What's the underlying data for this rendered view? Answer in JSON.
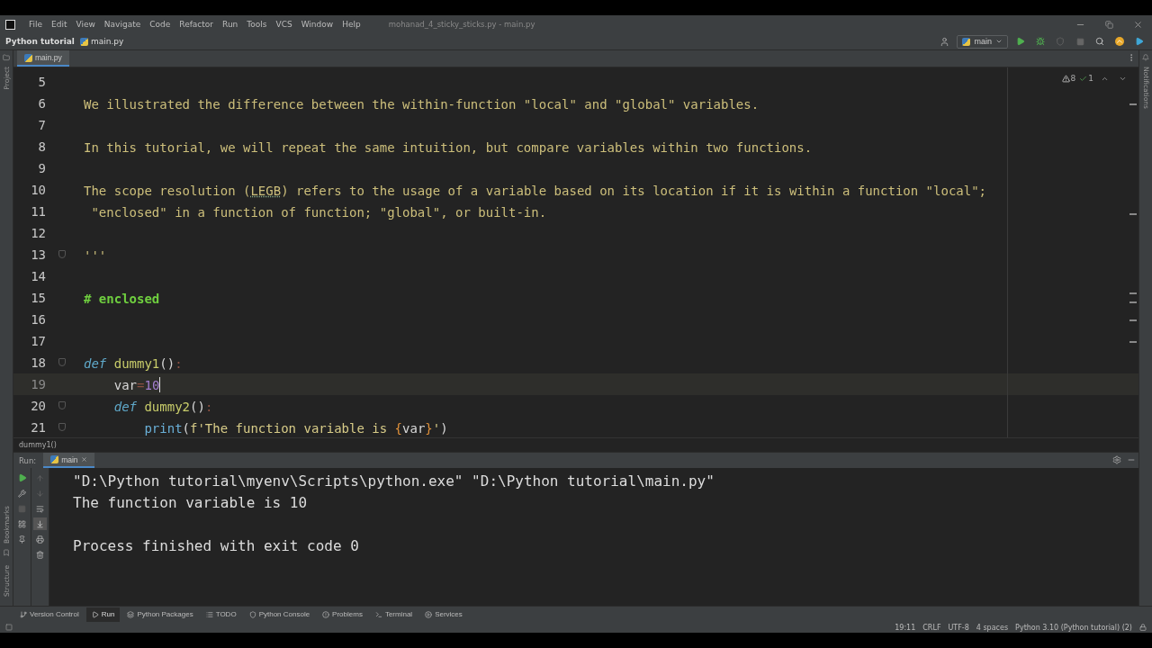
{
  "menu": {
    "items": [
      "File",
      "Edit",
      "View",
      "Navigate",
      "Code",
      "Refactor",
      "Run",
      "Tools",
      "VCS",
      "Window",
      "Help"
    ],
    "title": "mohanad_4_sticky_sticks.py - main.py"
  },
  "nav": {
    "project": "Python tutorial",
    "file": "main.py",
    "run_config": "main"
  },
  "left_strip": [
    "Project",
    "Bookmarks",
    "Structure"
  ],
  "right_strip": [
    "Notifications"
  ],
  "tabs": [
    {
      "label": "main.py",
      "selected": true
    }
  ],
  "inspections": {
    "warnings": "8",
    "weak": "1"
  },
  "editor": {
    "lines": [
      {
        "number": "5",
        "current": false,
        "fold": false
      },
      {
        "number": "6",
        "current": false,
        "fold": false,
        "tokens": [
          {
            "kind": "doc",
            "text": "We illustrated the difference between the within-function \"local\" and \"global\" variables."
          }
        ]
      },
      {
        "number": "7",
        "current": false,
        "fold": false
      },
      {
        "number": "8",
        "current": false,
        "fold": false,
        "tokens": [
          {
            "kind": "doc",
            "text": "In this tutorial, we will repeat the same intuition, but compare variables within two functions."
          }
        ]
      },
      {
        "number": "9",
        "current": false,
        "fold": false
      },
      {
        "number": "10",
        "current": false,
        "fold": false,
        "tokens": [
          {
            "kind": "doc",
            "text": "The scope resolution ("
          },
          {
            "kind": "typo",
            "text": "LEGB"
          },
          {
            "kind": "doc",
            "text": ") refers to the usage of a variable based on its location if it is within a function \"local\";"
          }
        ]
      },
      {
        "number": "11",
        "current": false,
        "fold": false,
        "tokens": [
          {
            "kind": "doc",
            "text": " \"enclosed\" in a function of function; \"global\", or built-in."
          }
        ]
      },
      {
        "number": "12",
        "current": false,
        "fold": false
      },
      {
        "number": "13",
        "current": false,
        "fold": true,
        "tokens": [
          {
            "kind": "doc",
            "text": "'''"
          }
        ]
      },
      {
        "number": "14",
        "current": false,
        "fold": false
      },
      {
        "number": "15",
        "current": false,
        "fold": false,
        "tokens": [
          {
            "kind": "comment",
            "text": "# enclosed"
          }
        ]
      },
      {
        "number": "16",
        "current": false,
        "fold": false
      },
      {
        "number": "17",
        "current": false,
        "fold": false
      },
      {
        "number": "18",
        "current": false,
        "fold": true,
        "tokens": [
          {
            "kind": "kw",
            "text": "def"
          },
          {
            "kind": "fn",
            "text": " dummy1"
          },
          {
            "kind": "plain",
            "text": "()"
          },
          {
            "kind": "colon",
            "text": ":"
          }
        ]
      },
      {
        "number": "19",
        "current": true,
        "fold": false,
        "tokens": [
          {
            "kind": "plain",
            "text": "    var"
          },
          {
            "kind": "colon",
            "text": "="
          },
          {
            "kind": "num",
            "text": "10"
          }
        ]
      },
      {
        "number": "20",
        "current": false,
        "fold": true,
        "tokens": [
          {
            "kind": "kw",
            "text": "    def"
          },
          {
            "kind": "fn",
            "text": " dummy2"
          },
          {
            "kind": "plain",
            "text": "()"
          },
          {
            "kind": "colon",
            "text": ":"
          }
        ]
      },
      {
        "number": "21",
        "current": false,
        "fold": true,
        "tokens": [
          {
            "kind": "builtin",
            "text": "        print"
          },
          {
            "kind": "plain",
            "text": "("
          },
          {
            "kind": "str",
            "text": "f'The function variable is "
          },
          {
            "kind": "brace",
            "text": "{"
          },
          {
            "kind": "plain",
            "text": "var"
          },
          {
            "kind": "brace",
            "text": "}"
          },
          {
            "kind": "str",
            "text": "'"
          },
          {
            "kind": "plain",
            "text": ")"
          }
        ]
      }
    ]
  },
  "breadcrumb": "dummy1()",
  "run": {
    "label": "Run:",
    "tab": "main",
    "output": [
      {
        "text": "\"D:\\Python tutorial\\myenv\\Scripts\\python.exe\" \"D:\\Python tutorial\\main.py\"",
        "gap_before": false
      },
      {
        "text": "The function variable is 10",
        "gap_before": false
      },
      {
        "text": "Process finished with exit code 0",
        "gap_before": true
      }
    ]
  },
  "tool_windows": [
    {
      "label": "Version Control",
      "selected": false
    },
    {
      "label": "Run",
      "selected": true
    },
    {
      "label": "Python Packages",
      "selected": false
    },
    {
      "label": "TODO",
      "selected": false
    },
    {
      "label": "Python Console",
      "selected": false
    },
    {
      "label": "Problems",
      "selected": false
    },
    {
      "label": "Terminal",
      "selected": false
    },
    {
      "label": "Services",
      "selected": false
    }
  ],
  "status": [
    "19:11",
    "CRLF",
    "UTF-8",
    "4 spaces",
    "Python 3.10 (Python tutorial) (2)"
  ]
}
